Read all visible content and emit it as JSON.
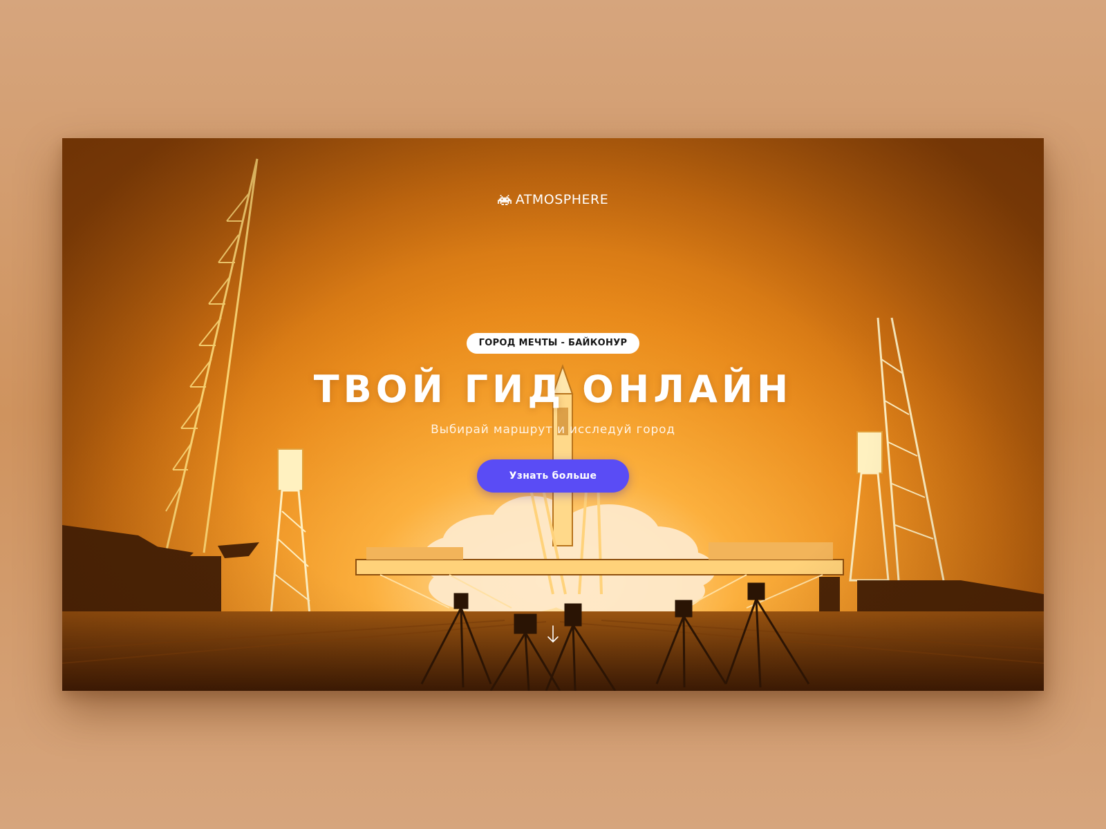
{
  "logo": {
    "icon": "space-invader-icon",
    "text": "ATMOSPHERE"
  },
  "hero": {
    "badge": "ГОРОД МЕЧТЫ - БАЙКОНУР",
    "headline": "ТВОЙ ГИД ОНЛАЙН",
    "subtitle": "Выбирай маршрут и исследуй город",
    "cta_label": "Узнать больше",
    "scroll_icon": "arrow-down-icon"
  },
  "colors": {
    "accent": "#5a4cf5",
    "sky_orange": "#e8891a",
    "page_background": "#d6a57d",
    "badge_background": "#ffffff"
  }
}
